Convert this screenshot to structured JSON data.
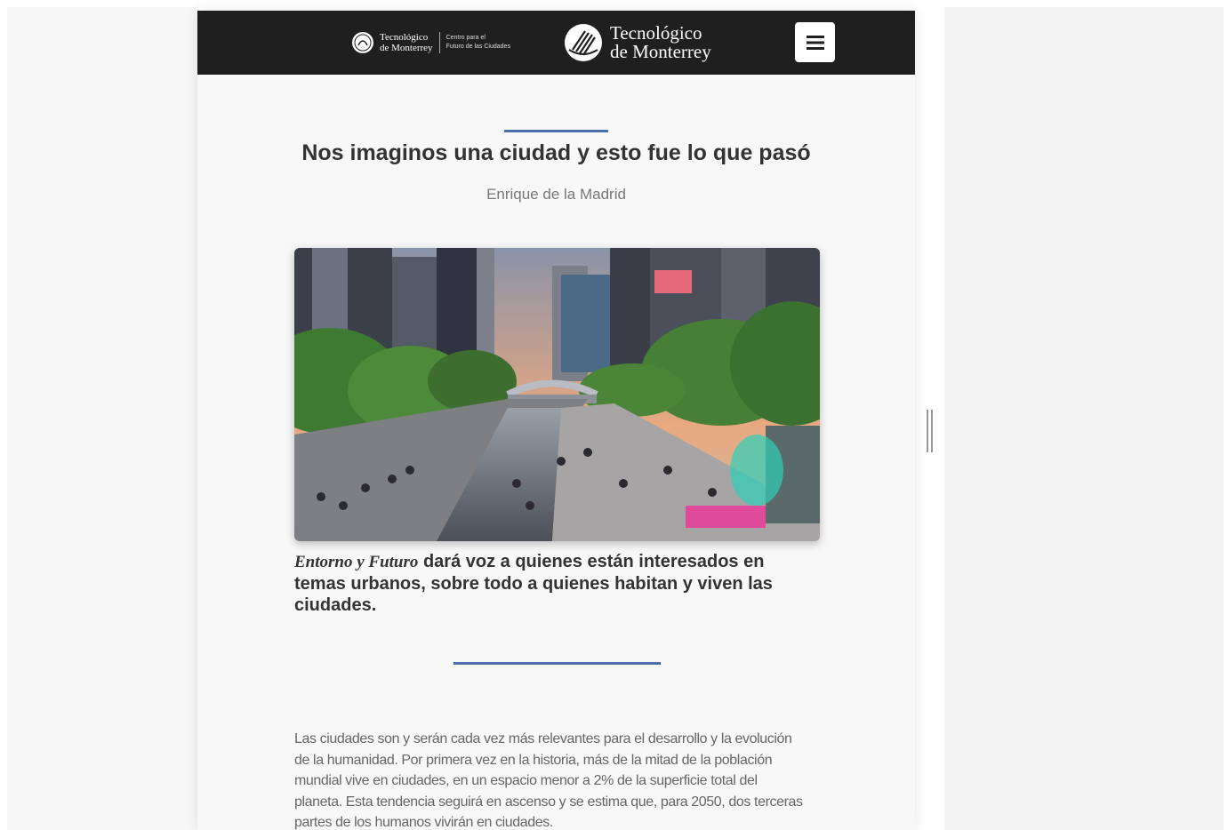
{
  "header": {
    "logo_small": {
      "name_line1": "Tecnológico",
      "name_line2": "de Monterrey",
      "sub_line1": "Centro para el",
      "sub_line2": "Futuro de las Ciudades"
    },
    "logo_main": {
      "line1": "Tecnológico",
      "line2": "de Monterrey"
    },
    "menu_icon": "hamburger-menu-icon"
  },
  "article": {
    "title": "Nos imaginos una ciudad y esto fue lo que pasó",
    "author": "Enrique de la Madrid",
    "image_icon": "city-canal-photo",
    "caption_emphasis": "Entorno y Futuro",
    "caption_rest": " dará voz a quienes están interesados en temas urbanos, sobre todo a quienes habitan y viven las ciudades.",
    "body": "Las ciudades son y serán cada vez más relevantes para el desarrollo y la evolución de la humanidad. Por primera vez en la historia, más de la mitad de la población mundial vive en ciudades, en un espacio menor a 2% de la superficie total del planeta. Esta tendencia seguirá en ascenso y se estima que, para 2050, dos terceras partes de los humanos vivirán en ciudades."
  },
  "colors": {
    "header_bg": "#1f1f1f",
    "accent": "#4a6ea8",
    "title": "#333333",
    "body": "#666666"
  }
}
